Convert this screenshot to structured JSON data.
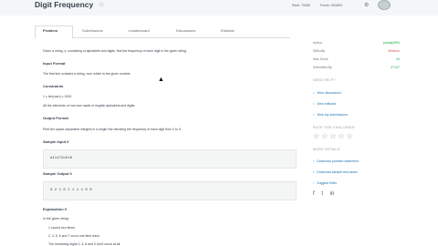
{
  "header": {
    "title": "Digit Frequency",
    "rank": "Rank: 79385",
    "points": "Points: 360/800"
  },
  "tabs": [
    "Problem",
    "Submissions",
    "Leaderboard",
    "Discussions",
    "Editorial"
  ],
  "problem": {
    "intro": "Given a string, s, consisting of alphabets and digits, find the frequency of each digit in the given string.",
    "input_format_heading": "Input Format",
    "input_format_text": "The first line contains a string, num which is the given number.",
    "constraints_heading": "Constraints",
    "constraint_1": "1 ≤ len(num) ≤ 1000",
    "constraint_2": "All the elements of num are made of english alphabets and digits.",
    "output_format_heading": "Output Format",
    "output_format_text": "Print ten space-separated integers in a single line denoting the frequency of each digit from 0 to 9.",
    "sample_input_heading": "Sample Input 0",
    "sample_input": "a11472o5t6",
    "sample_output_heading": "Sample Output 0",
    "sample_output": "0 2 1 0 1 1 1 1 0 0",
    "explanation_heading": "Explanation 0",
    "explanation_1": "In the given string:",
    "explanation_2": "1 occurs two times.",
    "explanation_3": "2, 4, 5, 6 and 7 occur one time each.",
    "explanation_4": "The remaining digits 0, 3, 8 and 9 don't occur at all."
  },
  "sidebar": {
    "author_label": "Author",
    "author_value": "pankaj4994",
    "difficulty_label": "Difficulty",
    "difficulty_value": "Medium",
    "max_score_label": "Max Score",
    "max_score_value": "20",
    "submitted_label": "Submitted By",
    "submitted_value": "47127",
    "need_help": "NEED HELP?",
    "help_links": [
      "View discussions",
      "View editorial",
      "View top submissions"
    ],
    "rate_heading": "RATE THIS CHALLENGE",
    "stars": "☆☆☆☆☆",
    "more_heading": "MORE DETAILS",
    "detail_links": [
      "Download problem statement",
      "Download sample test cases",
      "Suggest Edits"
    ]
  }
}
